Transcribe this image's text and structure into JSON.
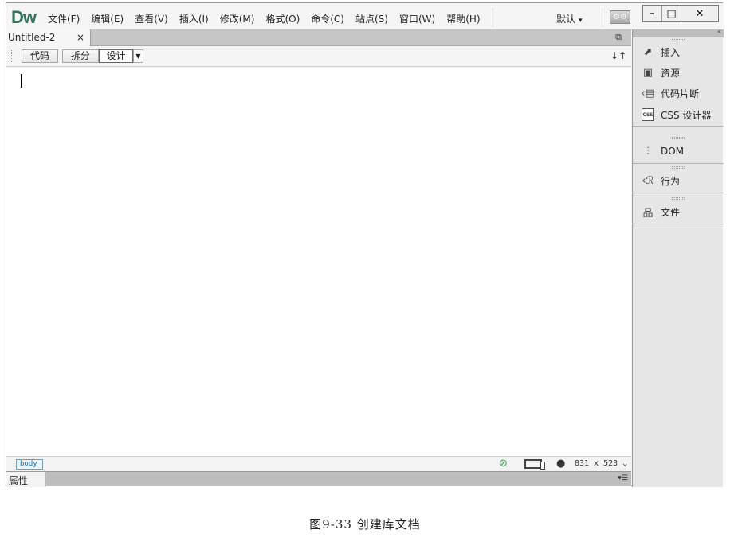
{
  "app": {
    "logo": "Dw"
  },
  "menubar": {
    "items": [
      "文件(F)",
      "编辑(E)",
      "查看(V)",
      "插入(I)",
      "修改(M)",
      "格式(O)",
      "命令(C)",
      "站点(S)",
      "窗口(W)",
      "帮助(H)"
    ],
    "workspace": "默认",
    "sync_icon": "sync-settings-icon"
  },
  "window_controls": {
    "min": "–",
    "max": "□",
    "close": "✕"
  },
  "document": {
    "tab_title": "Untitled-2",
    "tab_close": "×",
    "view_buttons": [
      "代码",
      "拆分",
      "设计"
    ],
    "active_view": "设计",
    "tag_selector": "body",
    "window_size": "831 x 523",
    "properties_tab": "属性"
  },
  "panel": {
    "groups": [
      {
        "items": [
          {
            "label": "插入",
            "icon": "insert-icon"
          },
          {
            "label": "资源",
            "icon": "assets-icon"
          },
          {
            "label": "代码片断",
            "icon": "snippets-icon"
          },
          {
            "label": "CSS 设计器",
            "icon": "css-designer-icon"
          }
        ]
      },
      {
        "items": [
          {
            "label": "DOM",
            "icon": "dom-icon"
          }
        ]
      },
      {
        "items": [
          {
            "label": "行为",
            "icon": "behaviors-icon"
          }
        ]
      },
      {
        "items": [
          {
            "label": "文件",
            "icon": "files-icon"
          }
        ]
      }
    ]
  },
  "caption": "图9-33  创建库文档"
}
